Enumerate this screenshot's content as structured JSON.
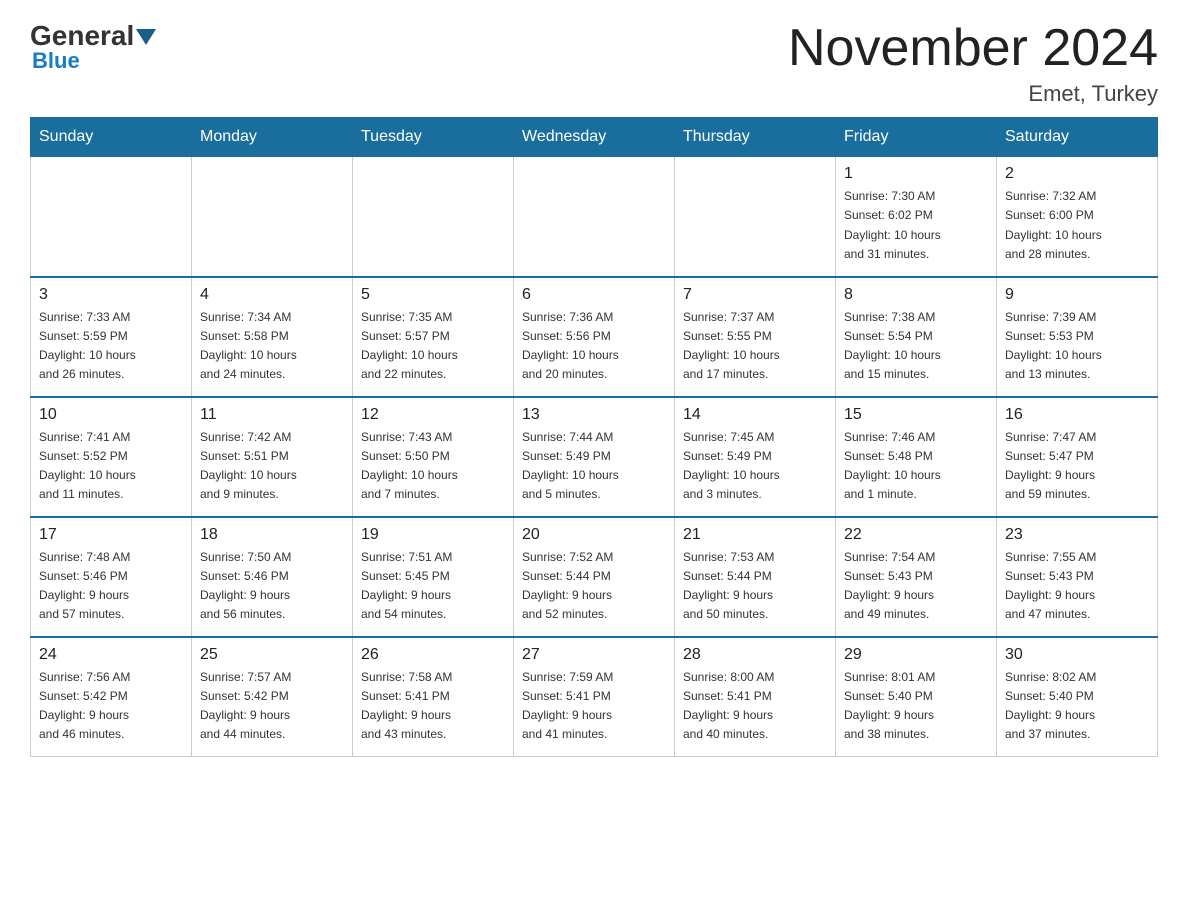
{
  "logo": {
    "general": "General",
    "blue": "Blue"
  },
  "title": "November 2024",
  "location": "Emet, Turkey",
  "days_header": [
    "Sunday",
    "Monday",
    "Tuesday",
    "Wednesday",
    "Thursday",
    "Friday",
    "Saturday"
  ],
  "weeks": [
    [
      {
        "day": "",
        "info": ""
      },
      {
        "day": "",
        "info": ""
      },
      {
        "day": "",
        "info": ""
      },
      {
        "day": "",
        "info": ""
      },
      {
        "day": "",
        "info": ""
      },
      {
        "day": "1",
        "info": "Sunrise: 7:30 AM\nSunset: 6:02 PM\nDaylight: 10 hours\nand 31 minutes."
      },
      {
        "day": "2",
        "info": "Sunrise: 7:32 AM\nSunset: 6:00 PM\nDaylight: 10 hours\nand 28 minutes."
      }
    ],
    [
      {
        "day": "3",
        "info": "Sunrise: 7:33 AM\nSunset: 5:59 PM\nDaylight: 10 hours\nand 26 minutes."
      },
      {
        "day": "4",
        "info": "Sunrise: 7:34 AM\nSunset: 5:58 PM\nDaylight: 10 hours\nand 24 minutes."
      },
      {
        "day": "5",
        "info": "Sunrise: 7:35 AM\nSunset: 5:57 PM\nDaylight: 10 hours\nand 22 minutes."
      },
      {
        "day": "6",
        "info": "Sunrise: 7:36 AM\nSunset: 5:56 PM\nDaylight: 10 hours\nand 20 minutes."
      },
      {
        "day": "7",
        "info": "Sunrise: 7:37 AM\nSunset: 5:55 PM\nDaylight: 10 hours\nand 17 minutes."
      },
      {
        "day": "8",
        "info": "Sunrise: 7:38 AM\nSunset: 5:54 PM\nDaylight: 10 hours\nand 15 minutes."
      },
      {
        "day": "9",
        "info": "Sunrise: 7:39 AM\nSunset: 5:53 PM\nDaylight: 10 hours\nand 13 minutes."
      }
    ],
    [
      {
        "day": "10",
        "info": "Sunrise: 7:41 AM\nSunset: 5:52 PM\nDaylight: 10 hours\nand 11 minutes."
      },
      {
        "day": "11",
        "info": "Sunrise: 7:42 AM\nSunset: 5:51 PM\nDaylight: 10 hours\nand 9 minutes."
      },
      {
        "day": "12",
        "info": "Sunrise: 7:43 AM\nSunset: 5:50 PM\nDaylight: 10 hours\nand 7 minutes."
      },
      {
        "day": "13",
        "info": "Sunrise: 7:44 AM\nSunset: 5:49 PM\nDaylight: 10 hours\nand 5 minutes."
      },
      {
        "day": "14",
        "info": "Sunrise: 7:45 AM\nSunset: 5:49 PM\nDaylight: 10 hours\nand 3 minutes."
      },
      {
        "day": "15",
        "info": "Sunrise: 7:46 AM\nSunset: 5:48 PM\nDaylight: 10 hours\nand 1 minute."
      },
      {
        "day": "16",
        "info": "Sunrise: 7:47 AM\nSunset: 5:47 PM\nDaylight: 9 hours\nand 59 minutes."
      }
    ],
    [
      {
        "day": "17",
        "info": "Sunrise: 7:48 AM\nSunset: 5:46 PM\nDaylight: 9 hours\nand 57 minutes."
      },
      {
        "day": "18",
        "info": "Sunrise: 7:50 AM\nSunset: 5:46 PM\nDaylight: 9 hours\nand 56 minutes."
      },
      {
        "day": "19",
        "info": "Sunrise: 7:51 AM\nSunset: 5:45 PM\nDaylight: 9 hours\nand 54 minutes."
      },
      {
        "day": "20",
        "info": "Sunrise: 7:52 AM\nSunset: 5:44 PM\nDaylight: 9 hours\nand 52 minutes."
      },
      {
        "day": "21",
        "info": "Sunrise: 7:53 AM\nSunset: 5:44 PM\nDaylight: 9 hours\nand 50 minutes."
      },
      {
        "day": "22",
        "info": "Sunrise: 7:54 AM\nSunset: 5:43 PM\nDaylight: 9 hours\nand 49 minutes."
      },
      {
        "day": "23",
        "info": "Sunrise: 7:55 AM\nSunset: 5:43 PM\nDaylight: 9 hours\nand 47 minutes."
      }
    ],
    [
      {
        "day": "24",
        "info": "Sunrise: 7:56 AM\nSunset: 5:42 PM\nDaylight: 9 hours\nand 46 minutes."
      },
      {
        "day": "25",
        "info": "Sunrise: 7:57 AM\nSunset: 5:42 PM\nDaylight: 9 hours\nand 44 minutes."
      },
      {
        "day": "26",
        "info": "Sunrise: 7:58 AM\nSunset: 5:41 PM\nDaylight: 9 hours\nand 43 minutes."
      },
      {
        "day": "27",
        "info": "Sunrise: 7:59 AM\nSunset: 5:41 PM\nDaylight: 9 hours\nand 41 minutes."
      },
      {
        "day": "28",
        "info": "Sunrise: 8:00 AM\nSunset: 5:41 PM\nDaylight: 9 hours\nand 40 minutes."
      },
      {
        "day": "29",
        "info": "Sunrise: 8:01 AM\nSunset: 5:40 PM\nDaylight: 9 hours\nand 38 minutes."
      },
      {
        "day": "30",
        "info": "Sunrise: 8:02 AM\nSunset: 5:40 PM\nDaylight: 9 hours\nand 37 minutes."
      }
    ]
  ]
}
